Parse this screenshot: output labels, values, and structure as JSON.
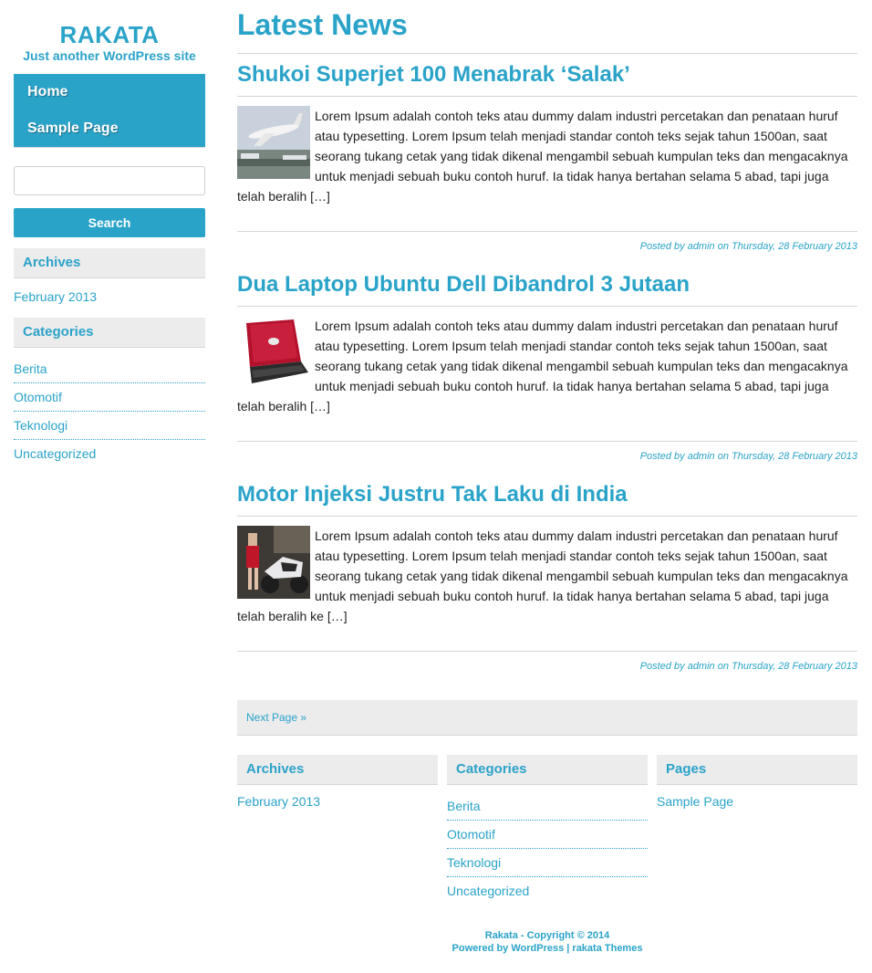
{
  "site": {
    "title": "RAKATA",
    "tagline": "Just another WordPress site"
  },
  "menu": {
    "items": [
      {
        "label": "Home"
      },
      {
        "label": "Sample Page"
      }
    ]
  },
  "search": {
    "placeholder": "",
    "button_label": "Search"
  },
  "sidebar": {
    "archives_title": "Archives",
    "archives": [
      "February 2013"
    ],
    "categories_title": "Categories",
    "categories": [
      "Berita",
      "Otomotif",
      "Teknologi",
      "Uncategorized"
    ]
  },
  "main": {
    "heading": "Latest News",
    "posts": [
      {
        "title": "Shukoi Superjet 100 Menabrak ‘Salak’",
        "excerpt": "Lorem Ipsum adalah contoh teks atau dummy dalam industri percetakan dan penataan huruf atau typesetting. Lorem Ipsum telah menjadi standar contoh teks sejak tahun 1500an, saat seorang tukang cetak yang tidak dikenal mengambil sebuah kumpulan teks dan mengacaknya untuk menjadi sebuah buku contoh huruf. Ia tidak hanya bertahan selama 5 abad, tapi juga telah beralih […]",
        "meta": "Posted by admin on Thursday, 28 February 2013",
        "thumb": "airplane-image"
      },
      {
        "title": "Dua Laptop Ubuntu Dell Dibandrol 3 Jutaan",
        "excerpt": "Lorem Ipsum adalah contoh teks atau dummy dalam industri percetakan dan penataan huruf atau typesetting. Lorem Ipsum telah menjadi standar contoh teks sejak tahun 1500an, saat seorang tukang cetak yang tidak dikenal mengambil sebuah kumpulan teks dan mengacaknya untuk menjadi sebuah buku contoh huruf. Ia tidak hanya bertahan selama 5 abad, tapi juga telah beralih […]",
        "meta": "Posted by admin on Thursday, 28 February 2013",
        "thumb": "laptop-image"
      },
      {
        "title": "Motor Injeksi Justru Tak Laku di India",
        "excerpt": "Lorem Ipsum adalah contoh teks atau dummy dalam industri percetakan dan penataan huruf atau typesetting. Lorem Ipsum telah menjadi standar contoh teks sejak tahun 1500an, saat seorang tukang cetak yang tidak dikenal mengambil sebuah kumpulan teks dan mengacaknya untuk menjadi sebuah buku contoh huruf. Ia tidak hanya bertahan selama 5 abad, tapi juga telah beralih ke […]",
        "meta": "Posted by admin on Thursday, 28 February 2013",
        "thumb": "motorcycle-image"
      }
    ]
  },
  "pager": {
    "next_label": "Next Page »"
  },
  "footer_widgets": {
    "archives_title": "Archives",
    "archives": [
      "February 2013"
    ],
    "categories_title": "Categories",
    "categories": [
      "Berita",
      "Otomotif",
      "Teknologi",
      "Uncategorized"
    ],
    "pages_title": "Pages",
    "pages": [
      "Sample Page"
    ]
  },
  "credits": {
    "line1": "Rakata - Copyright © 2014",
    "line2": "Powered by WordPress | rakata Themes"
  },
  "colors": {
    "accent": "#2aa3c9",
    "widget_bg": "#ececec",
    "text": "#222222"
  }
}
